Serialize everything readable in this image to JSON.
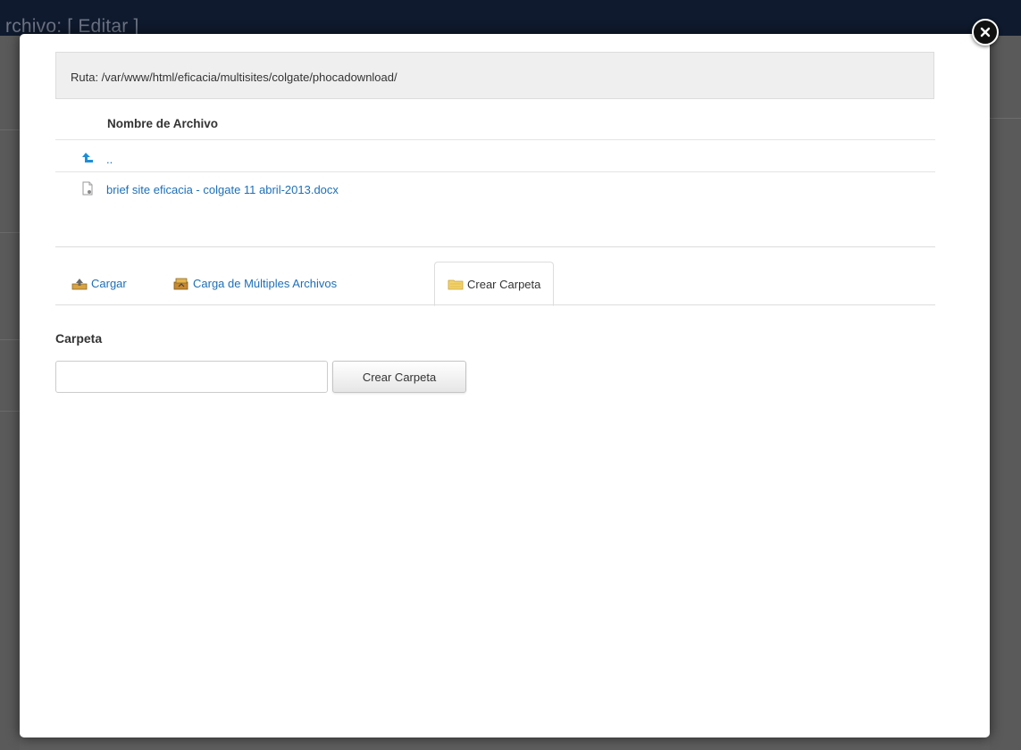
{
  "background": {
    "title": "rchivo: [ Editar ]"
  },
  "dialog": {
    "path": "Ruta: /var/www/html/eficacia/multisites/colgate/phocadownload/",
    "file_table": {
      "column_header": "Nombre de Archivo",
      "rows": [
        {
          "icon": "folder-up-icon",
          "label": ".."
        },
        {
          "icon": "document-icon",
          "label": "brief site eficacia - colgate 11 abril-2013.docx"
        }
      ]
    },
    "tabs": [
      {
        "label": "Cargar",
        "icon": "upload-icon",
        "active": false
      },
      {
        "label": "Carga de Múltiples Archivos",
        "icon": "multi-upload-icon",
        "active": false
      },
      {
        "label": "Crear Carpeta",
        "icon": "folder-icon",
        "active": true
      }
    ],
    "form": {
      "label": "Carpeta",
      "input_value": "",
      "button_label": "Crear Carpeta"
    }
  },
  "colors": {
    "link": "#1d6fb8",
    "overlay": "#5e5e5e",
    "header_bar": "#0f1a2e"
  }
}
